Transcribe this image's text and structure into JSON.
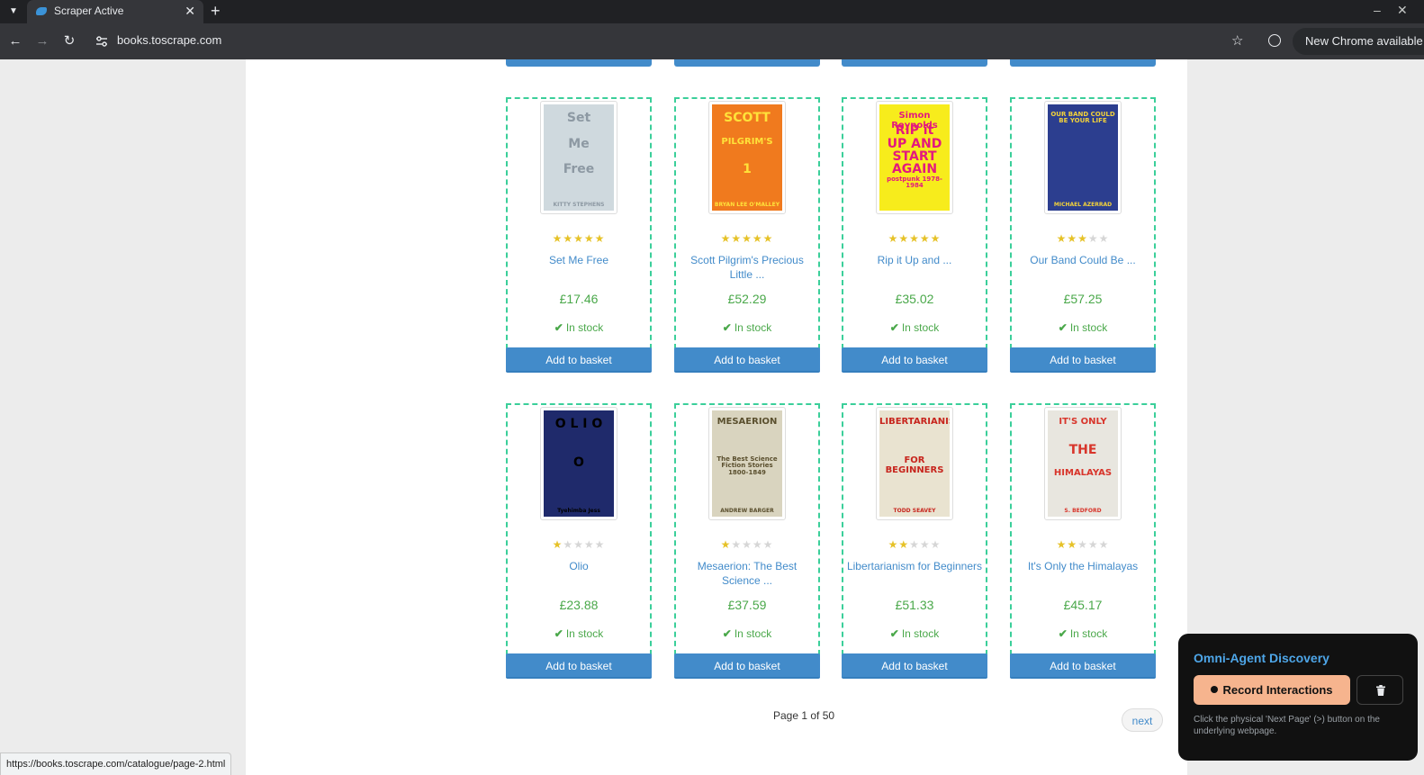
{
  "browser": {
    "tab_title": "Scraper Active",
    "tab_close": "✕",
    "new_tab": "+",
    "url": "books.toscrape.com",
    "update_text": "New Chrome available",
    "status_url": "https://books.toscrape.com/catalogue/page-2.html"
  },
  "books": [
    {
      "title": "Set Me Free",
      "price": "£17.46",
      "stock": "In stock",
      "rating": 5,
      "basket": "Add to basket"
    },
    {
      "title": "Scott Pilgrim's Precious Little ...",
      "price": "£52.29",
      "stock": "In stock",
      "rating": 5,
      "basket": "Add to basket"
    },
    {
      "title": "Rip it Up and ...",
      "price": "£35.02",
      "stock": "In stock",
      "rating": 5,
      "basket": "Add to basket"
    },
    {
      "title": "Our Band Could Be ...",
      "price": "£57.25",
      "stock": "In stock",
      "rating": 3,
      "basket": "Add to basket"
    },
    {
      "title": "Olio",
      "price": "£23.88",
      "stock": "In stock",
      "rating": 1,
      "basket": "Add to basket"
    },
    {
      "title": "Mesaerion: The Best Science ...",
      "price": "£37.59",
      "stock": "In stock",
      "rating": 1,
      "basket": "Add to basket"
    },
    {
      "title": "Libertarianism for Beginners",
      "price": "£51.33",
      "stock": "In stock",
      "rating": 2,
      "basket": "Add to basket"
    },
    {
      "title": "It's Only the Himalayas",
      "price": "£45.17",
      "stock": "In stock",
      "rating": 2,
      "basket": "Add to basket"
    }
  ],
  "covers": [
    {
      "lines": [
        "Set",
        "Me",
        "Free"
      ],
      "author": "KITTY STEPHENS",
      "bg": "#cfd9de",
      "fg": "#8d99a3"
    },
    {
      "lines": [
        "SCOTT",
        "PILGRIM'S",
        "1"
      ],
      "author": "BRYAN LEE O'MALLEY",
      "bg": "#f07a1e",
      "fg": "#ffe23a"
    },
    {
      "lines": [
        "Simon Reynolds",
        "RIP it",
        "UP AND",
        "START",
        "AGAIN",
        "postpunk 1978-1984"
      ],
      "author": "",
      "bg": "#f7ec1c",
      "fg": "#e3197e"
    },
    {
      "lines": [
        "OUR BAND COULD BE YOUR LIFE"
      ],
      "author": "MICHAEL AZERRAD",
      "bg": "#2c3e8f",
      "fg": "#f3d23a"
    },
    {
      "lines": [
        "O L I O",
        "O"
      ],
      "author": "Tyehimba Jess",
      "bg": "#1f2a6b",
      "fg": "#000000"
    },
    {
      "lines": [
        "MESAERION",
        "The Best Science Fiction Stories 1800-1849"
      ],
      "author": "ANDREW BARGER",
      "bg": "#d9d4bf",
      "fg": "#5a4f2e"
    },
    {
      "lines": [
        "LIBERTARIANISM",
        "FOR BEGINNERS"
      ],
      "author": "TODD SEAVEY",
      "bg": "#e9e3d0",
      "fg": "#c7251d"
    },
    {
      "lines": [
        "IT'S ONLY",
        "THE",
        "HIMALAYAS"
      ],
      "author": "S. BEDFORD",
      "bg": "#e8e6df",
      "fg": "#d8352b"
    }
  ],
  "pager": {
    "current": "Page 1 of 50",
    "next": "next"
  },
  "overlay": {
    "title": "Omni-Agent Discovery",
    "record_label": "Record Interactions",
    "hint": "Click the physical 'Next Page' (>) button on the underlying webpage."
  },
  "colors": {
    "accent": "#428bca",
    "price": "#4aa84a",
    "outline": "#3bcf9a",
    "record": "#f6b48e"
  }
}
